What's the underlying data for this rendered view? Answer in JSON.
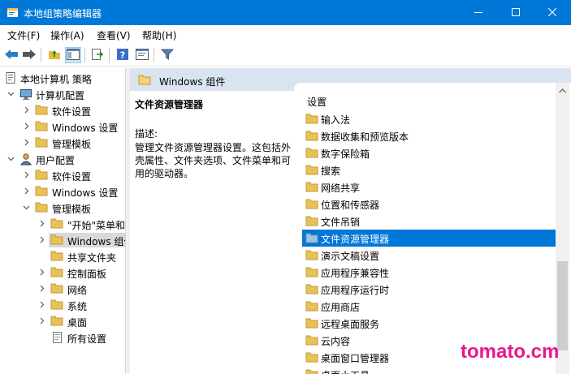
{
  "window": {
    "title": "本地组策略编辑器",
    "accent": "#0078d7",
    "icon": "gpedit-icon"
  },
  "menu": [
    {
      "label": "文件(F)"
    },
    {
      "label": "操作(A)"
    },
    {
      "label": "查看(V)"
    },
    {
      "label": "帮助(H)"
    }
  ],
  "toolbar": [
    "back-icon",
    "forward-icon",
    "up-folder-icon",
    "show-hide-tree-icon",
    "export-list-icon",
    "help-icon",
    "properties-icon",
    "filter-icon"
  ],
  "tree": {
    "items": [
      {
        "label": "本地计算机 策略",
        "icon": "policy-icon",
        "expanded": true
      },
      {
        "label": "计算机配置",
        "icon": "computer-icon",
        "expanded": true
      },
      {
        "label": "软件设置",
        "icon": "folder-icon",
        "expanded": false
      },
      {
        "label": "Windows 设置",
        "icon": "folder-icon",
        "expanded": false
      },
      {
        "label": "管理模板",
        "icon": "folder-icon",
        "expanded": false
      },
      {
        "label": "用户配置",
        "icon": "user-icon",
        "expanded": true
      },
      {
        "label": "软件设置",
        "icon": "folder-icon",
        "expanded": false
      },
      {
        "label": "Windows 设置",
        "icon": "folder-icon",
        "expanded": false
      },
      {
        "label": "管理模板",
        "icon": "folder-icon",
        "expanded": true
      },
      {
        "label": "\"开始\"菜单和",
        "icon": "folder-icon",
        "expanded": false
      },
      {
        "label": "Windows 组件",
        "icon": "folder-icon",
        "expanded": false,
        "selected": true
      },
      {
        "label": "共享文件夹",
        "icon": "folder-icon",
        "expanded": false
      },
      {
        "label": "控制面板",
        "icon": "folder-icon",
        "expanded": false
      },
      {
        "label": "网络",
        "icon": "folder-icon",
        "expanded": false
      },
      {
        "label": "系统",
        "icon": "folder-icon",
        "expanded": false
      },
      {
        "label": "桌面",
        "icon": "folder-icon",
        "expanded": false
      },
      {
        "label": "所有设置",
        "icon": "settings-page-icon",
        "expanded": false
      }
    ]
  },
  "right": {
    "header": "Windows 组件",
    "extended": {
      "title": "文件资源管理器",
      "desc_heading": "描述:",
      "desc": "管理文件资源管理器设置。这包括外壳属性、文件夹选项、文件菜单和可用的驱动器。"
    },
    "column_header": "设置",
    "items": [
      {
        "label": "输入法"
      },
      {
        "label": "数据收集和预览版本"
      },
      {
        "label": "数字保险箱"
      },
      {
        "label": "搜索"
      },
      {
        "label": "网络共享"
      },
      {
        "label": "位置和传感器"
      },
      {
        "label": "文件吊销"
      },
      {
        "label": "文件资源管理器",
        "selected": true
      },
      {
        "label": "演示文稿设置"
      },
      {
        "label": "应用程序兼容性"
      },
      {
        "label": "应用程序运行时"
      },
      {
        "label": "应用商店"
      },
      {
        "label": "远程桌面服务"
      },
      {
        "label": "云内容"
      },
      {
        "label": "桌面窗口管理器"
      },
      {
        "label": "桌面小工具"
      }
    ]
  },
  "watermark": "tomato.cm"
}
